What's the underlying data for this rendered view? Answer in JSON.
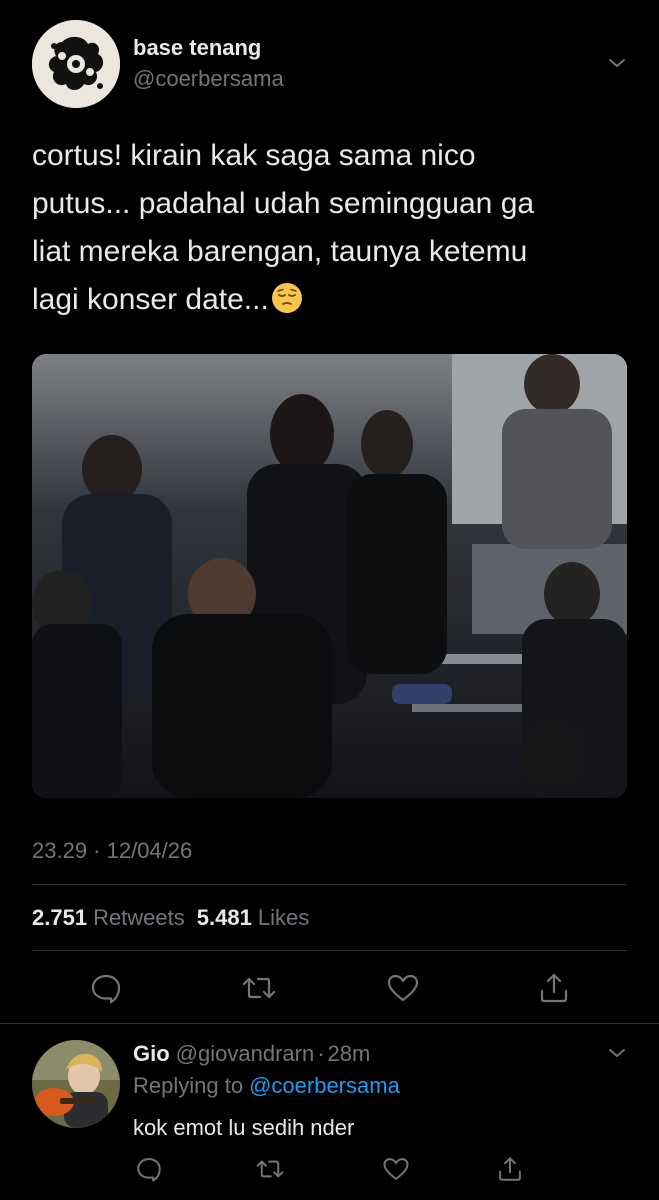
{
  "tweet": {
    "author_name": "base tenang",
    "author_handle": "@coerbersama",
    "text_lines": [
      "cortus! kirain kak saga sama nico",
      "putus... padahal udah semingguan ga",
      "liat mereka barengan, taunya ketemu",
      "lagi konser date..."
    ],
    "emoji": "pensive-face",
    "timestamp": "23.29 · 12/04/26",
    "retweets_count": "2.751",
    "retweets_label": "Retweets",
    "likes_count": "5.481",
    "likes_label": "Likes"
  },
  "actions": {
    "reply": "reply-icon",
    "retweet": "retweet-icon",
    "like": "heart-icon",
    "share": "share-icon"
  },
  "reply": {
    "author_name": "Gio",
    "author_handle": "@giovandrarn",
    "separator": "·",
    "time": "28m",
    "replying_label": "Replying to",
    "replying_to": "@coerbersama",
    "text": "kok emot lu sedih nder"
  },
  "colors": {
    "background": "#000000",
    "primary_text": "#e7e9ea",
    "secondary_text": "#71767b",
    "link": "#1d9bf0",
    "divider": "#2f3336"
  }
}
